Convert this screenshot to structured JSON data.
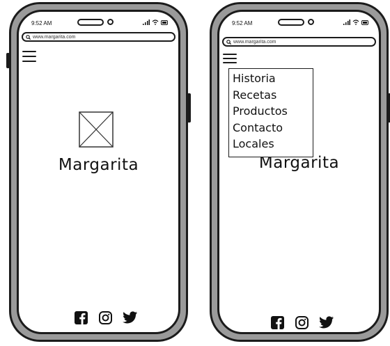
{
  "status": {
    "time": "9:52 AM"
  },
  "browser": {
    "url": "www.margarita.com"
  },
  "brand": {
    "name": "Margarita"
  },
  "menu": {
    "items": [
      {
        "label": "Historia"
      },
      {
        "label": "Recetas"
      },
      {
        "label": "Productos"
      },
      {
        "label": "Contacto"
      },
      {
        "label": "Locales"
      }
    ]
  },
  "social": {
    "icons": [
      "facebook-icon",
      "instagram-icon",
      "twitter-icon"
    ]
  },
  "colors": {
    "outline": "#1b1b1b",
    "frame": "#9a9a9a",
    "screen": "#ffffff"
  }
}
